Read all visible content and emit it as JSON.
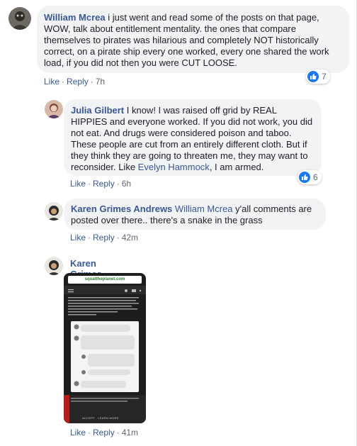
{
  "comments": [
    {
      "author": "William Mcrea",
      "text": " i just went and read some of the posts on that page, WOW, talk about entitlement mentality. the ones that compare themselves to pirates was hilarious and completely NOT historically correct, on a pirate ship every one worked, every one shared the work load, if you did not then you were CUT LOOSE.",
      "actions": {
        "like": "Like",
        "reply": "Reply",
        "time": "7h"
      },
      "reaction_count": "7"
    },
    {
      "author": "Julia Gilbert",
      "text": " I know! I was raised off grid by REAL HIPPIES and everyone worked. If you did not work, you did not eat. And drugs were considered poison and taboo. These people are cut from an entirely different cloth. But if they think they are going to threaten me, they may want to reconsider. Like ",
      "mention": "Evelyn Hammock",
      "text_after": ", I am armed.",
      "actions": {
        "like": "Like",
        "reply": "Reply",
        "time": "6h"
      },
      "reaction_count": "6"
    },
    {
      "author": "Karen Grimes Andrews",
      "mention": "William Mcrea",
      "text": " y'all comments are posted over there.. there's a snake in the grass",
      "actions": {
        "like": "Like",
        "reply": "Reply",
        "time": "42m"
      }
    },
    {
      "author": "Karen Grimes Andrews",
      "attachment": {
        "site": "squattheplanet.com",
        "accept": "ACCEPT",
        "learn_more": "LEARN MORE"
      },
      "actions": {
        "like": "Like",
        "reply": "Reply",
        "time": "41m"
      }
    }
  ],
  "colors": {
    "link": "#385898",
    "bubble": "#f2f3f5",
    "like_blue": "#1877f2",
    "meta": "#606770"
  },
  "icons": {
    "reaction": "like-thumb-icon"
  }
}
